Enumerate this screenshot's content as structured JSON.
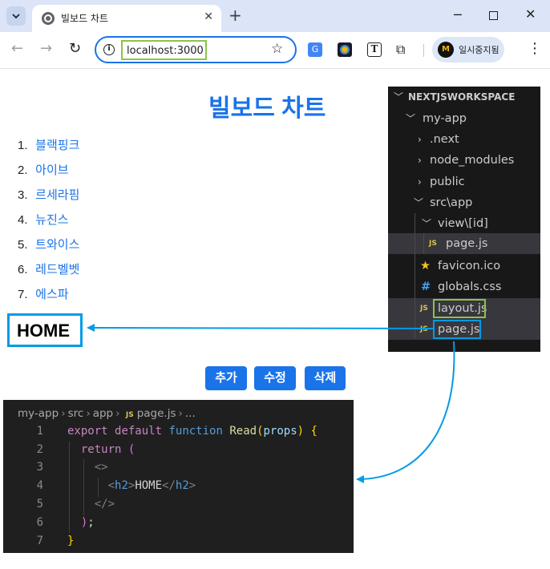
{
  "browser": {
    "tab_title": "빌보드 차트",
    "tab_close": "✕",
    "new_tab": "+",
    "url": "localhost:3000",
    "profile_name": "일시중지됨",
    "window": {
      "minimize": "─",
      "close": "✕"
    },
    "nav": {
      "back": "←",
      "forward": "→",
      "reload": "↻"
    },
    "extensions": [
      "translate-icon",
      "multicolor-extension-icon",
      "text-extension-icon",
      "puzzle-icon"
    ]
  },
  "page": {
    "title": "빌보드 차트",
    "groups": [
      {
        "num": "1.",
        "name": "블랙핑크"
      },
      {
        "num": "2.",
        "name": "아이브"
      },
      {
        "num": "3.",
        "name": "르세라핌"
      },
      {
        "num": "4.",
        "name": "뉴진스"
      },
      {
        "num": "5.",
        "name": "트와이스"
      },
      {
        "num": "6.",
        "name": "레드벨벳"
      },
      {
        "num": "7.",
        "name": "에스파"
      }
    ],
    "home_text": "HOME",
    "buttons": {
      "add": "추가",
      "edit": "수정",
      "delete": "삭제"
    }
  },
  "explorer": {
    "workspace": "NEXTJSWORKSPACE",
    "items": {
      "my_app": "my-app",
      "next": ".next",
      "node_modules": "node_modules",
      "public": "public",
      "src_app": "src\\app",
      "view_id": "view\\[id]",
      "view_page": "page.js",
      "favicon": "favicon.ico",
      "globals": "globals.css",
      "layout": "layout.js",
      "page": "page.js"
    },
    "js_badge": "JS"
  },
  "editor": {
    "breadcrumb": {
      "a": "my-app",
      "b": "src",
      "c": "app",
      "d": "page.js",
      "e": "..."
    },
    "line_numbers": [
      "1",
      "2",
      "3",
      "4",
      "5",
      "6",
      "7"
    ],
    "code": {
      "export": "export",
      "default": "default",
      "function": "function",
      "fn_name": "Read",
      "param": "props",
      "return": "return",
      "h2": "h2",
      "home": "HOME"
    }
  },
  "colors": {
    "accent": "#1a73e8",
    "arrow": "#039be5",
    "highlight_green": "#8bc34a",
    "explorer_bg": "#181818",
    "editor_bg": "#1f1f1f"
  }
}
